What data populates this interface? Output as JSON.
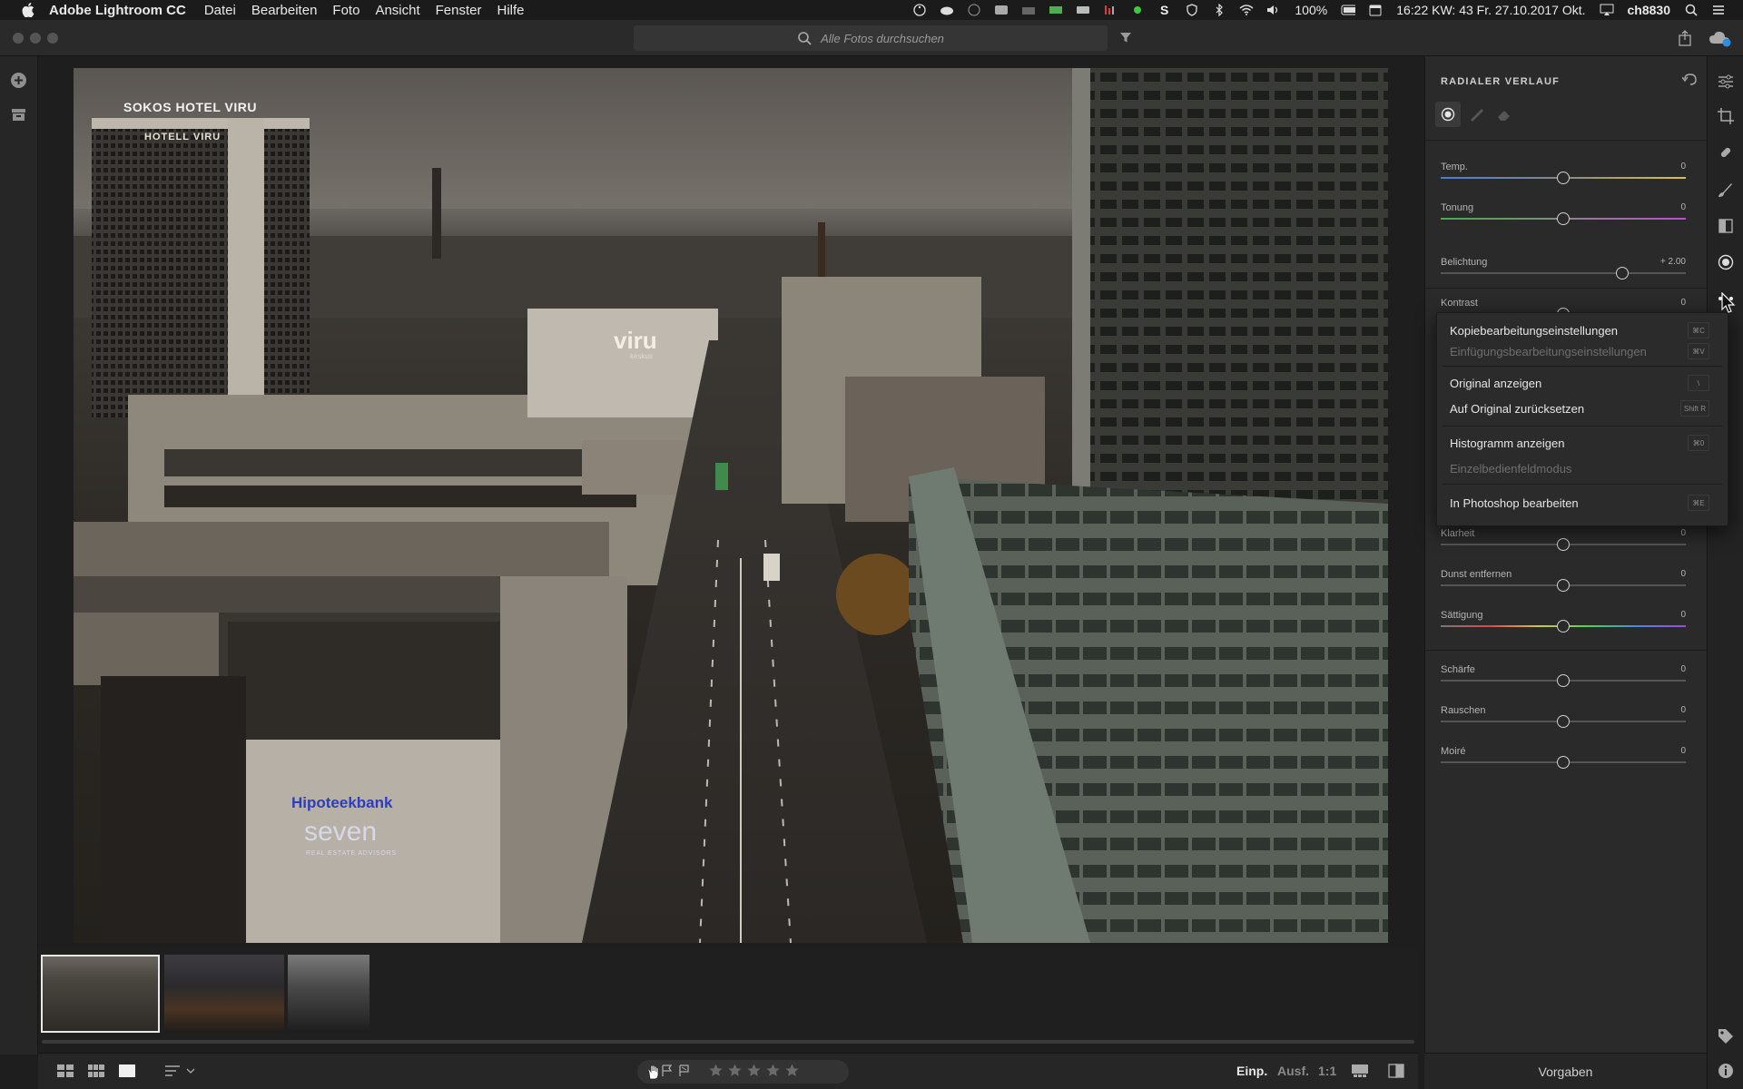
{
  "menubar": {
    "app_name": "Adobe Lightroom CC",
    "items": [
      "Datei",
      "Bearbeiten",
      "Foto",
      "Ansicht",
      "Fenster",
      "Hilfe"
    ],
    "battery": "100%",
    "datetime": "16:22 KW: 43 Fr. 27.10.2017 Okt.",
    "user": "ch8830"
  },
  "toolbar": {
    "search_placeholder": "Alle Fotos durchsuchen"
  },
  "photo": {
    "sign_hotel": "SOKOS HOTEL VIRU",
    "sign_hotel_sub": "HOTELL VIRU",
    "sign_viru": "viru",
    "sign_viru_sub": "keskus",
    "sign_bank": "Hipoteekbank",
    "sign_seven": "seven",
    "sign_seven_sub": "REAL ESTATE ADVISORS"
  },
  "right_panel": {
    "title": "RADIALER VERLAUF",
    "sliders": [
      {
        "label": "Temp.",
        "value": "0",
        "pos": 0.5
      },
      {
        "label": "Tonung",
        "value": "0",
        "pos": 0.5
      },
      {
        "label": "Belichtung",
        "value": "+ 2.00",
        "pos": 0.74
      },
      {
        "label": "Kontrast",
        "value": "0",
        "pos": 0.5
      },
      {
        "label": "Klarheit",
        "value": "0",
        "pos": 0.5
      },
      {
        "label": "Dunst entfernen",
        "value": "0",
        "pos": 0.5
      },
      {
        "label": "Sättigung",
        "value": "0",
        "pos": 0.5
      },
      {
        "label": "Schärfe",
        "value": "0",
        "pos": 0.5
      },
      {
        "label": "Rauschen",
        "value": "0",
        "pos": 0.5
      },
      {
        "label": "Moiré",
        "value": "0",
        "pos": 0.5
      }
    ],
    "presets_label": "Vorgaben"
  },
  "context_menu": {
    "items": [
      {
        "label": "Kopiebearbeitungseinstellungen",
        "shortcut": "⌘C",
        "enabled": true
      },
      {
        "label": "Einfügungsbearbeitungseinstellungen",
        "shortcut": "⌘V",
        "enabled": false
      },
      {
        "label": "Original anzeigen",
        "shortcut": "\\",
        "enabled": true
      },
      {
        "label": "Auf Original zurücksetzen",
        "shortcut": "Shift R",
        "enabled": true
      },
      {
        "label": "Histogramm anzeigen",
        "shortcut": "⌘0",
        "enabled": true
      },
      {
        "label": "Einzelbedienfeldmodus",
        "shortcut": "",
        "enabled": false
      },
      {
        "label": "In Photoshop bearbeiten",
        "shortcut": "⌘E",
        "enabled": true
      }
    ]
  },
  "bottombar": {
    "fit_label": "Einp.",
    "fill_label": "Ausf.",
    "ratio_label": "1:1"
  },
  "colors": {
    "background": "#1e1e1e",
    "panel": "#2a2a2a",
    "accent": "#e04a2f"
  }
}
